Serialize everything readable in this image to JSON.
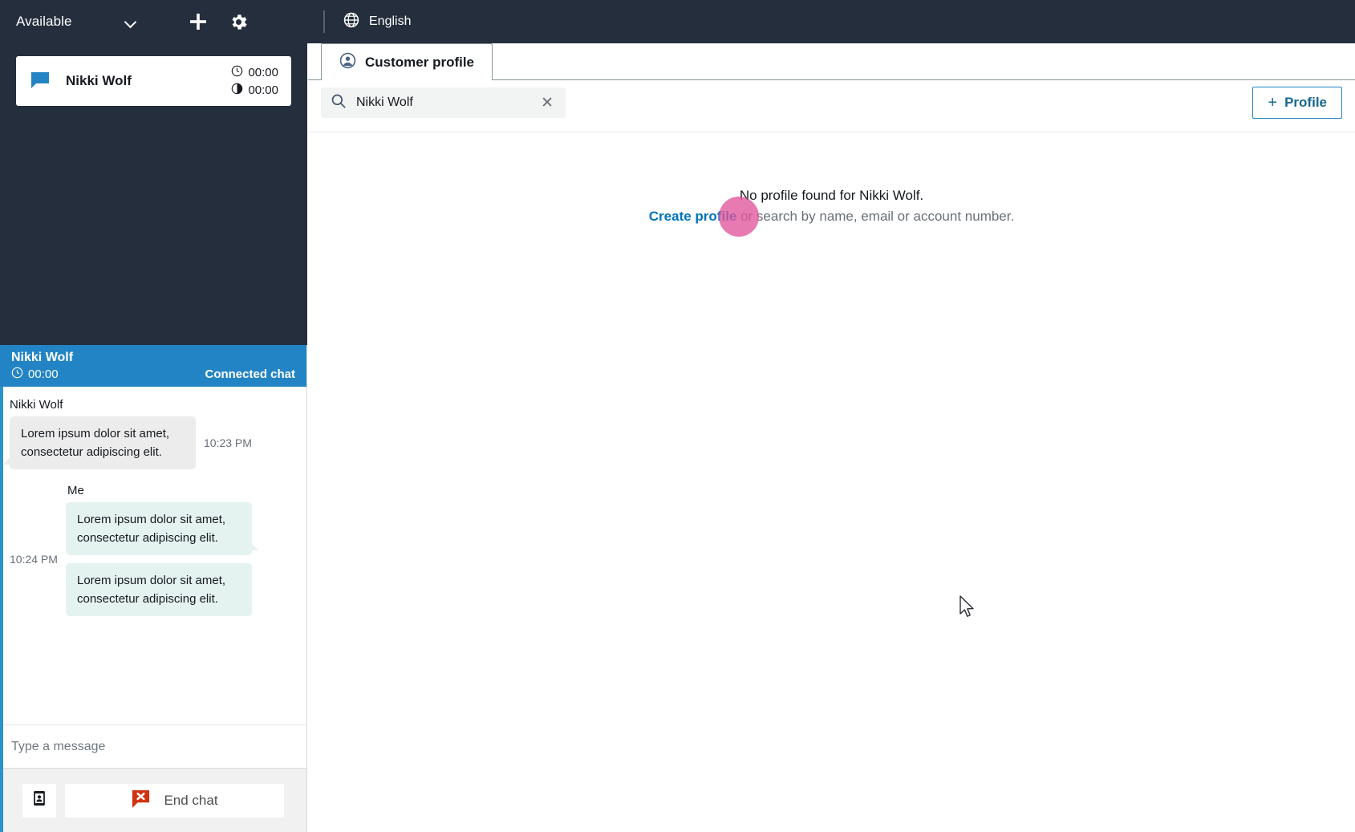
{
  "topbar": {
    "status_label": "Available",
    "status_chevron_icon": "chevron-down-icon",
    "add_icon": "plus-icon",
    "settings_icon": "gear-icon",
    "language_icon": "globe-icon",
    "language_label": "English"
  },
  "contact_list": {
    "items": [
      {
        "icon": "chat-bubble-icon",
        "name": "Nikki Wolf",
        "timer_primary_icon": "clock-icon",
        "timer_primary": "00:00",
        "timer_secondary_icon": "half-moon-clock-icon",
        "timer_secondary": "00:00"
      }
    ]
  },
  "chat": {
    "header": {
      "name": "Nikki Wolf",
      "timer_icon": "clock-icon",
      "timer": "00:00",
      "state": "Connected chat"
    },
    "messages": [
      {
        "sender": "Nikki Wolf",
        "direction": "inbound",
        "timestamp": "10:23 PM",
        "bubbles": [
          "Lorem ipsum dolor sit amet, consectetur adipiscing elit."
        ]
      },
      {
        "sender": "Me",
        "direction": "outbound",
        "timestamp": "10:24 PM",
        "bubbles": [
          "Lorem ipsum dolor sit amet, consectetur adipiscing elit.",
          "Lorem ipsum dolor sit amet, consectetur adipiscing elit."
        ]
      }
    ],
    "input_placeholder": "Type a message",
    "actions": {
      "contact_icon": "contact-card-icon",
      "end_chat_icon": "end-chat-icon",
      "end_chat_label": "End chat"
    }
  },
  "main": {
    "tabs": [
      {
        "icon": "user-circle-icon",
        "label": "Customer profile",
        "active": true
      }
    ],
    "search": {
      "icon": "search-icon",
      "value": "Nikki Wolf",
      "placeholder": "Search by name, email or account number",
      "clear_icon": "close-icon"
    },
    "profile_button": {
      "plus_icon": "plus-icon",
      "label": "Profile"
    },
    "empty_state": {
      "line1": "No profile found for Nikki Wolf.",
      "link": "Create profile",
      "line2_rest": " or search by name, email or account number."
    }
  },
  "colors": {
    "topbar_bg": "#242E3D",
    "chat_header_bg": "#2284C4",
    "accent_blue": "#2284C4",
    "link_blue": "#0073bb",
    "end_chat_red": "#d13212",
    "inbound_bubble": "#ececec",
    "outbound_bubble": "#e4f2f0",
    "click_indicator": "#e0559b"
  }
}
